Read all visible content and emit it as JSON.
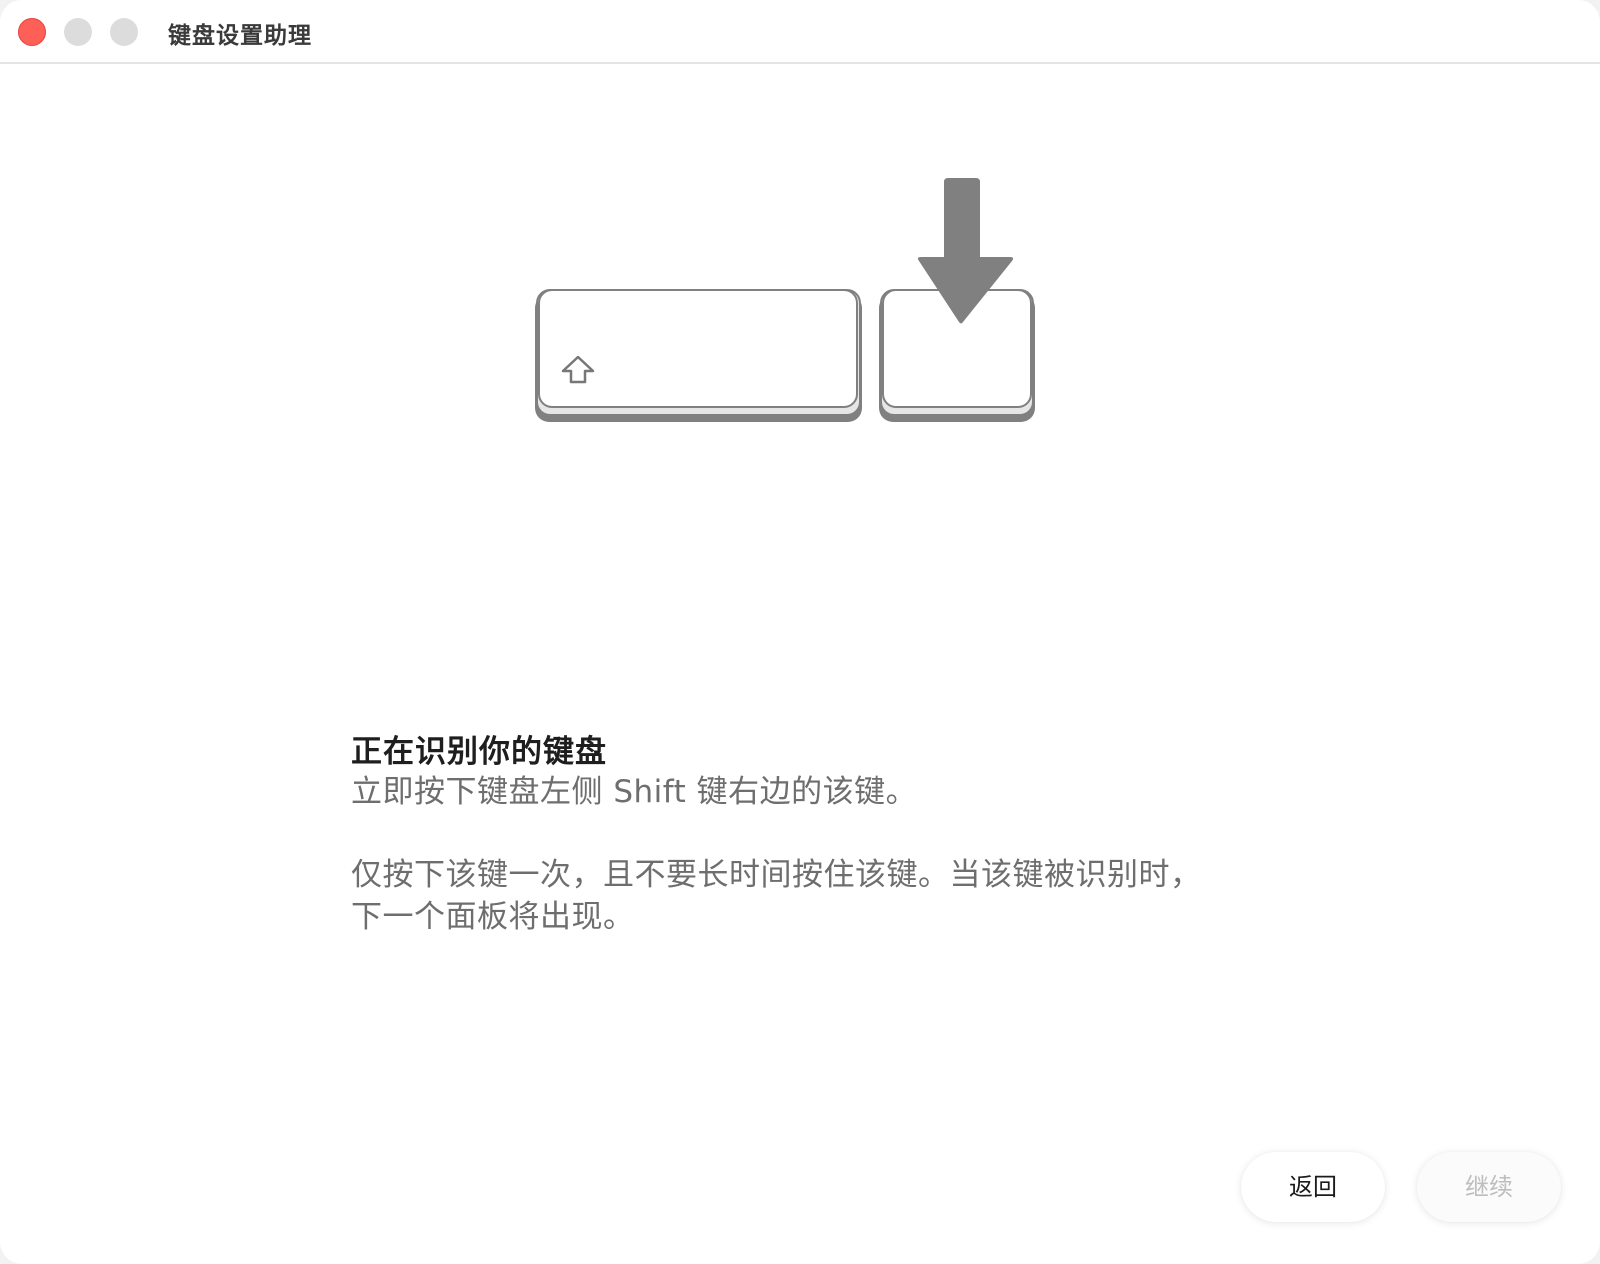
{
  "window": {
    "title": "键盘设置助理"
  },
  "content": {
    "heading": "正在识别你的键盘",
    "instruction": "立即按下键盘左侧 Shift 键右边的该键。",
    "note_line1": "仅按下该键一次，且不要长时间按住该键。当该键被识别时，",
    "note_line2": "下一个面板将出现。"
  },
  "buttons": {
    "back": "返回",
    "continue": "继续"
  },
  "icons": {
    "shift": "shift-arrow-icon",
    "press": "down-arrow-icon"
  },
  "colors": {
    "close": "#fe5f57",
    "inactive_light": "#dcdcdc",
    "arrow": "#808080"
  }
}
